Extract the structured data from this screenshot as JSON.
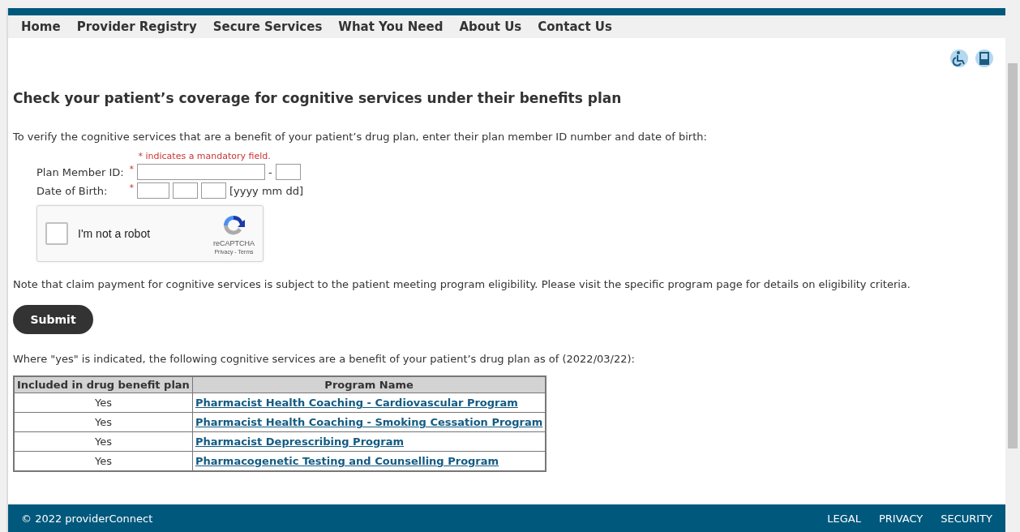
{
  "nav": [
    "Home",
    "Provider Registry",
    "Secure Services",
    "What You Need",
    "About Us",
    "Contact Us"
  ],
  "heading": "Check your patient’s coverage for cognitive services under their benefits plan",
  "intro": "To verify the cognitive services that are a benefit of your patient’s drug plan, enter their plan member ID number and date of birth:",
  "form": {
    "mandatory_note": "* indicates a mandatory field.",
    "required_mark": "*",
    "member_id_label": "Plan Member ID:",
    "separator": "-",
    "dob_label": "Date of Birth:",
    "dob_hint": "[yyyy mm dd]"
  },
  "captcha": {
    "label": "I'm not a robot",
    "checked": false,
    "brand": "reCAPTCHA",
    "links": "Privacy - Terms"
  },
  "note": "Note that claim payment for cognitive services is subject to the patient meeting program eligibility. Please visit the specific program page for details on eligibility criteria.",
  "submit": "Submit",
  "table_intro": "Where \"yes\" is indicated, the following cognitive services are a benefit of your patient’s drug plan as of (2022/03/22):",
  "table": {
    "columns": [
      "Included in drug benefit plan",
      "Program Name"
    ],
    "rows": [
      {
        "included": "Yes",
        "program": "Pharmacist Health Coaching - Cardiovascular Program"
      },
      {
        "included": "Yes",
        "program": "Pharmacist Health Coaching - Smoking Cessation Program"
      },
      {
        "included": "Yes",
        "program": "Pharmacist Deprescribing Program"
      },
      {
        "included": "Yes",
        "program": "Pharmacogenetic Testing and Counselling Program"
      }
    ]
  },
  "footer": {
    "copyright": "© 2022 providerConnect",
    "links": [
      "LEGAL",
      "PRIVACY",
      "SECURITY"
    ]
  }
}
